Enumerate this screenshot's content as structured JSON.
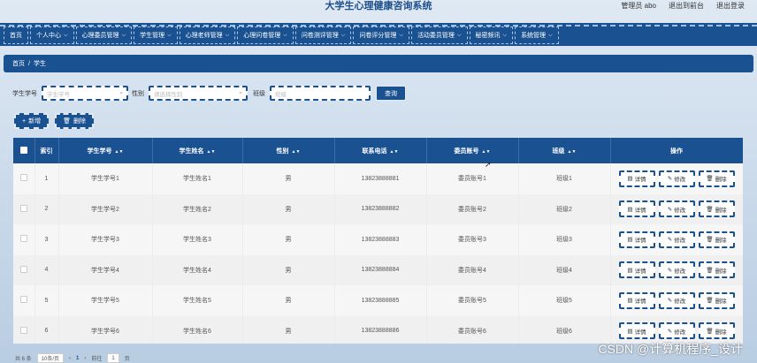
{
  "header": {
    "title": "大学生心理健康咨询系统",
    "links": [
      "管理员 abo",
      "退出到前台",
      "退出登录"
    ]
  },
  "nav": [
    "首页",
    "个人中心",
    "心理委员管理",
    "学生管理",
    "心理老师管理",
    "心理问卷管理",
    "问卷测评管理",
    "问卷评分管理",
    "活动委员管理",
    "秘密频讯",
    "系统管理"
  ],
  "breadcrumb": {
    "home": "首页",
    "sep": "/",
    "current": "学生"
  },
  "search": {
    "student_no_label": "学生学号",
    "student_no_placeholder": "学生学号",
    "gender_label": "性别",
    "gender_placeholder": "请选择性别",
    "class_label": "班级",
    "class_placeholder": "班级",
    "button": "查询"
  },
  "actions": {
    "add": "新增",
    "delete": "删除"
  },
  "table": {
    "headers": [
      "索引",
      "学生学号",
      "学生姓名",
      "性别",
      "联系电话",
      "委员账号",
      "班级",
      "操作"
    ],
    "row_buttons": {
      "detail": "详情",
      "edit": "修改",
      "delete": "删除"
    },
    "rows": [
      {
        "index": "1",
        "no": "学生学号1",
        "name": "学生姓名1",
        "gender": "男",
        "phone": "13823888881",
        "account": "委员账号1",
        "class": "班级1"
      },
      {
        "index": "2",
        "no": "学生学号2",
        "name": "学生姓名2",
        "gender": "男",
        "phone": "13823888882",
        "account": "委员账号2",
        "class": "班级2"
      },
      {
        "index": "3",
        "no": "学生学号3",
        "name": "学生姓名3",
        "gender": "男",
        "phone": "13823888883",
        "account": "委员账号3",
        "class": "班级3"
      },
      {
        "index": "4",
        "no": "学生学号4",
        "name": "学生姓名4",
        "gender": "男",
        "phone": "13823888884",
        "account": "委员账号4",
        "class": "班级4"
      },
      {
        "index": "5",
        "no": "学生学号5",
        "name": "学生姓名5",
        "gender": "男",
        "phone": "13823888885",
        "account": "委员账号5",
        "class": "班级5"
      },
      {
        "index": "6",
        "no": "学生学号6",
        "name": "学生姓名6",
        "gender": "男",
        "phone": "13823888886",
        "account": "委员账号6",
        "class": "班级6"
      }
    ]
  },
  "pager": {
    "total": "共 6 条",
    "page_size": "10条/页",
    "page": "1",
    "goto_label": "前往",
    "goto_value": "1",
    "page_unit": "页"
  },
  "watermark": "CSDN @计算机程序_设计",
  "colors": {
    "primary": "#1a5190",
    "background": "#dfe9f3"
  }
}
